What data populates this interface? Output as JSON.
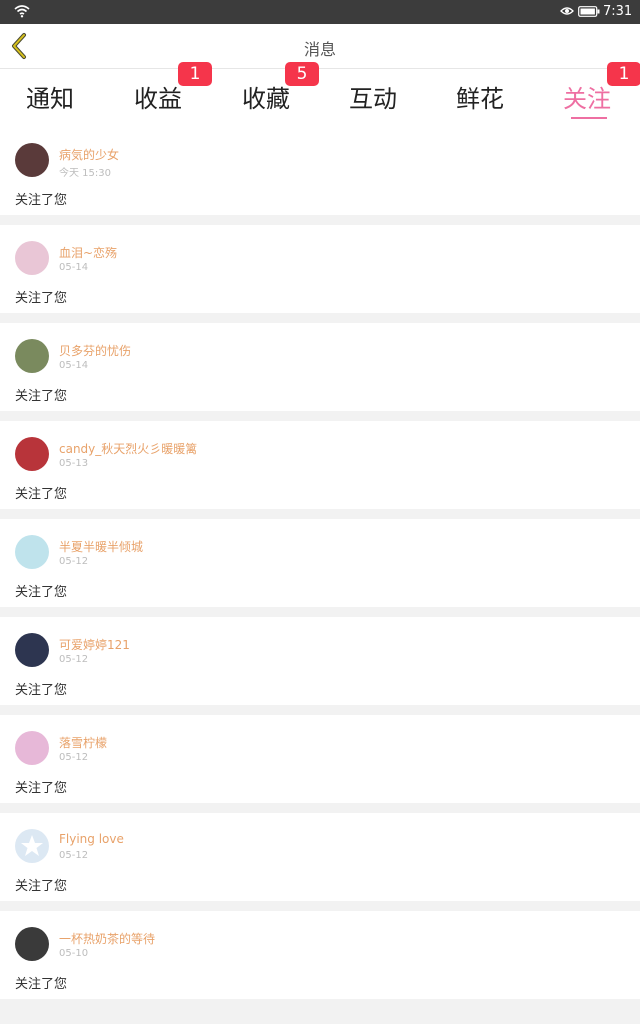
{
  "status_bar": {
    "time": "7:31"
  },
  "nav": {
    "title": "消息"
  },
  "tabs": [
    {
      "label": "通知",
      "badge": ""
    },
    {
      "label": "收益",
      "badge": "1"
    },
    {
      "label": "收藏",
      "badge": "5"
    },
    {
      "label": "互动",
      "badge": ""
    },
    {
      "label": "鲜花",
      "badge": ""
    },
    {
      "label": "关注",
      "badge": "1",
      "active": true
    }
  ],
  "colors": {
    "accent": "#ee6fa2",
    "badge": "#f5354b",
    "username": "#e8a26a",
    "background": "#f2f2f2"
  },
  "notifications": [
    {
      "name": "病気的少女",
      "date": "今天 15:30",
      "action": "关注了您",
      "avatar_color": "#5a3a3a"
    },
    {
      "name": "血泪~恋殇",
      "date": "05-14",
      "action": "关注了您",
      "avatar_color": "#e9c6d6"
    },
    {
      "name": "贝多芬的忧伤",
      "date": "05-14",
      "action": "关注了您",
      "avatar_color": "#7a8a5e"
    },
    {
      "name": "candy_秋天烈火彡暖暖篱",
      "date": "05-13",
      "action": "关注了您",
      "avatar_color": "#b8343a"
    },
    {
      "name": "半夏半暖半倾城",
      "date": "05-12",
      "action": "关注了您",
      "avatar_color": "#bfe3ec"
    },
    {
      "name": "可爱婷婷121",
      "date": "05-12",
      "action": "关注了您",
      "avatar_color": "#2d3550"
    },
    {
      "name": "落雪柠檬",
      "date": "05-12",
      "action": "关注了您",
      "avatar_color": "#e7b8d8"
    },
    {
      "name": "Flying love",
      "date": "05-12",
      "action": "关注了您",
      "avatar_color": "#dce8f3"
    },
    {
      "name": "一杯热奶茶的等待",
      "date": "05-10",
      "action": "关注了您",
      "avatar_color": "#3a3a3a"
    }
  ]
}
